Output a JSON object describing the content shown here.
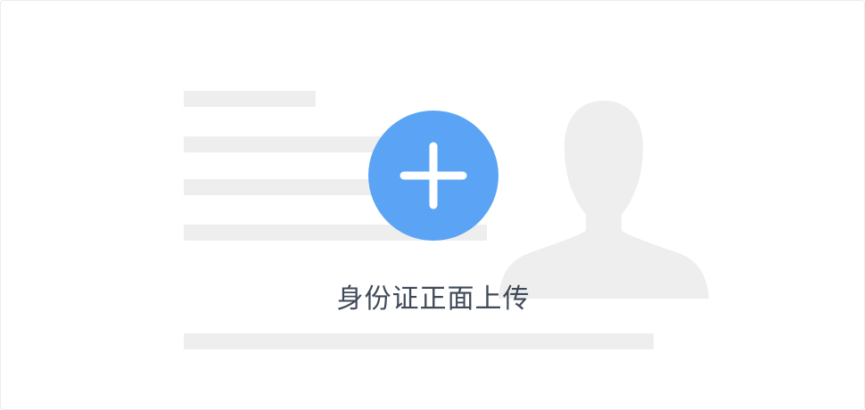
{
  "upload": {
    "label": "身份证正面上传"
  },
  "icons": {
    "add": "plus-icon",
    "portrait": "person-silhouette-icon"
  },
  "colors": {
    "accent": "#5ba4f5",
    "placeholder": "#eeeeee",
    "label_text": "#3f4a59"
  }
}
